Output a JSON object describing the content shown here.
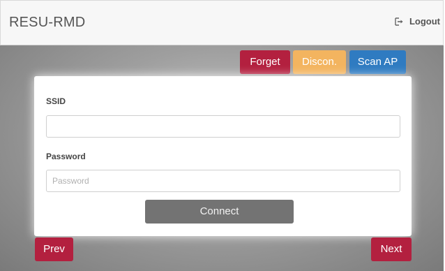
{
  "header": {
    "brand": "RESU-RMD",
    "logout_label": "Logout"
  },
  "toolbar": {
    "forget_label": "Forget",
    "discon_label": "Discon.",
    "scan_label": "Scan AP"
  },
  "form": {
    "ssid_label": "SSID",
    "ssid_value": "",
    "password_label": "Password",
    "password_placeholder": "Password",
    "connect_label": "Connect"
  },
  "nav": {
    "prev_label": "Prev",
    "next_label": "Next"
  },
  "colors": {
    "danger": "#b3203f",
    "warning": "#f3b45f",
    "primary": "#2f7bc1",
    "neutral": "#737373"
  },
  "icons": {
    "logout": "logout-icon"
  }
}
